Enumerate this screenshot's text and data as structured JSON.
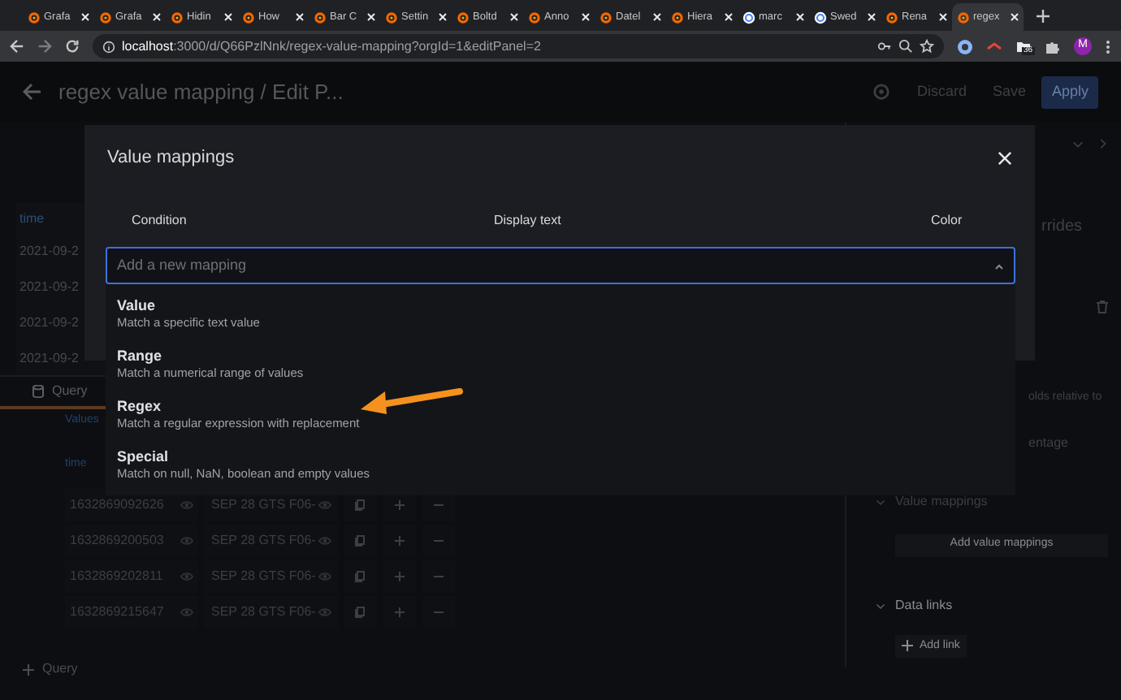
{
  "browser": {
    "tabs": [
      {
        "label": "Grafa",
        "kind": "grafana",
        "selected": false
      },
      {
        "label": "Grafa",
        "kind": "grafana",
        "selected": false
      },
      {
        "label": "Hidin",
        "kind": "grafana",
        "selected": false
      },
      {
        "label": "How",
        "kind": "grafana",
        "selected": false
      },
      {
        "label": "Bar C",
        "kind": "grafana",
        "selected": false
      },
      {
        "label": "Settin",
        "kind": "grafana",
        "selected": false
      },
      {
        "label": "Boltd",
        "kind": "grafana",
        "selected": false
      },
      {
        "label": "Anno",
        "kind": "grafana",
        "selected": false
      },
      {
        "label": "Datel",
        "kind": "grafana",
        "selected": false
      },
      {
        "label": "Hiera",
        "kind": "grafana",
        "selected": false
      },
      {
        "label": "marc",
        "kind": "google",
        "selected": false
      },
      {
        "label": "Swed",
        "kind": "google",
        "selected": false
      },
      {
        "label": "Rena",
        "kind": "grafana",
        "selected": false
      },
      {
        "label": "regex",
        "kind": "grafana",
        "selected": true
      }
    ],
    "url_host": "localhost",
    "url_path": ":3000/d/Q66PzlNnk/regex-value-mapping?orgId=1&editPanel=2",
    "extension_badge": "36",
    "avatar": "M"
  },
  "header": {
    "title": "regex value mapping / Edit P...",
    "buttons": [
      "Discard",
      "Save",
      "Apply"
    ]
  },
  "panel_preview": {
    "column": "time",
    "cells": [
      "2021-09-2",
      "2021-09-2",
      "2021-09-2",
      "2021-09-2"
    ]
  },
  "query": {
    "tab": "Query",
    "section": "Values",
    "column": "time",
    "rows": [
      {
        "value": "1632869092626",
        "text": "SEP 28 GTS F06-"
      },
      {
        "value": "1632869200503",
        "text": "SEP 28 GTS F06-"
      },
      {
        "value": "1632869202811",
        "text": "SEP 28 GTS F06-"
      },
      {
        "value": "1632869215647",
        "text": "SEP 28 GTS F06-"
      }
    ],
    "add_query": "Query"
  },
  "options_pane": {
    "texts": [
      "rrides",
      "olds relative to",
      "entage"
    ],
    "value_mappings": "Value mappings",
    "add_value_mappings": "Add value mappings",
    "data_links": "Data links",
    "add_link": "Add link"
  },
  "modal": {
    "title": "Value mappings",
    "columns": [
      "Condition",
      "Display text",
      "Color"
    ],
    "select": {
      "placeholder": "Add a new mapping",
      "expanded": true
    },
    "options": [
      {
        "label": "Value",
        "description": "Match a specific text value"
      },
      {
        "label": "Range",
        "description": "Match a numerical range of values"
      },
      {
        "label": "Regex",
        "description": "Match a regular expression with replacement"
      },
      {
        "label": "Special",
        "description": "Match on null, NaN, boolean and empty values"
      }
    ]
  }
}
